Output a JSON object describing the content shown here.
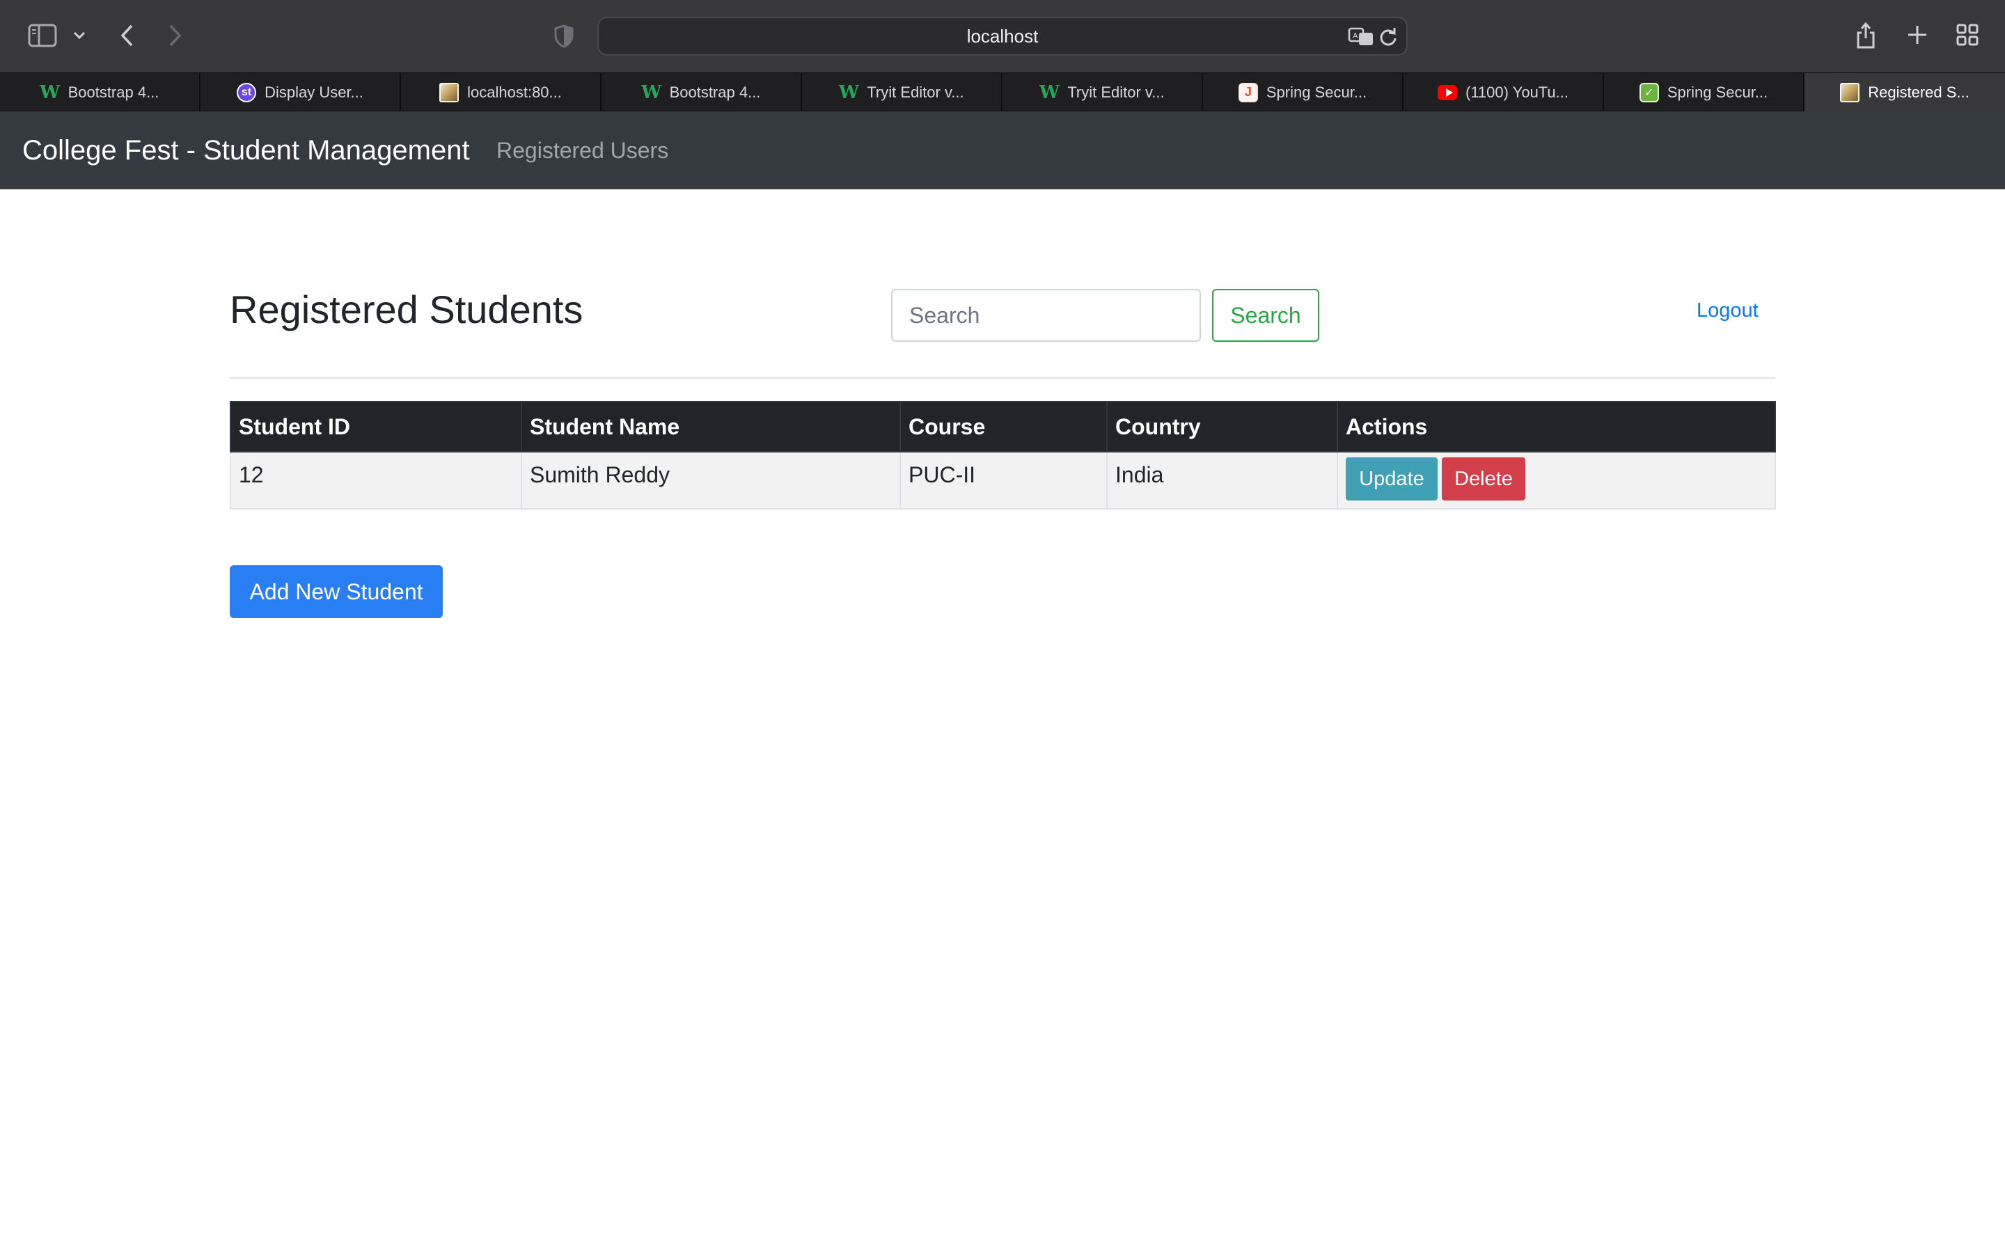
{
  "browser": {
    "url": "localhost",
    "tabs": [
      {
        "title": "Bootstrap 4...",
        "icon": "w3schools-icon"
      },
      {
        "title": "Display User...",
        "icon": "st-icon"
      },
      {
        "title": "localhost:80...",
        "icon": "image-favicon-icon"
      },
      {
        "title": "Bootstrap 4...",
        "icon": "w3schools-icon"
      },
      {
        "title": "Tryit Editor v...",
        "icon": "w3schools-icon"
      },
      {
        "title": "Tryit Editor v...",
        "icon": "w3schools-icon"
      },
      {
        "title": "Spring Secur...",
        "icon": "j-icon"
      },
      {
        "title": "(1100) YouTu...",
        "icon": "youtube-icon"
      },
      {
        "title": "Spring Secur...",
        "icon": "spring-icon"
      },
      {
        "title": "Registered S...",
        "icon": "image-favicon-icon",
        "active": true
      }
    ]
  },
  "navbar": {
    "brand": "College Fest - Student Management",
    "link": "Registered Users"
  },
  "main": {
    "title": "Registered Students",
    "search_placeholder": "Search",
    "search_button": "Search",
    "logout": "Logout",
    "add_button": "Add New Student"
  },
  "table": {
    "headers": [
      "Student ID",
      "Student Name",
      "Course",
      "Country",
      "Actions"
    ],
    "rows": [
      {
        "id": "12",
        "name": "Sumith Reddy",
        "course": "PUC-II",
        "country": "India",
        "update_label": "Update",
        "delete_label": "Delete"
      }
    ]
  },
  "colors": {
    "navbar_bg": "#343a40",
    "table_header_bg": "#212529",
    "success": "#28a745",
    "info": "#17a2b8",
    "danger": "#dc3545",
    "primary": "#007bff"
  }
}
